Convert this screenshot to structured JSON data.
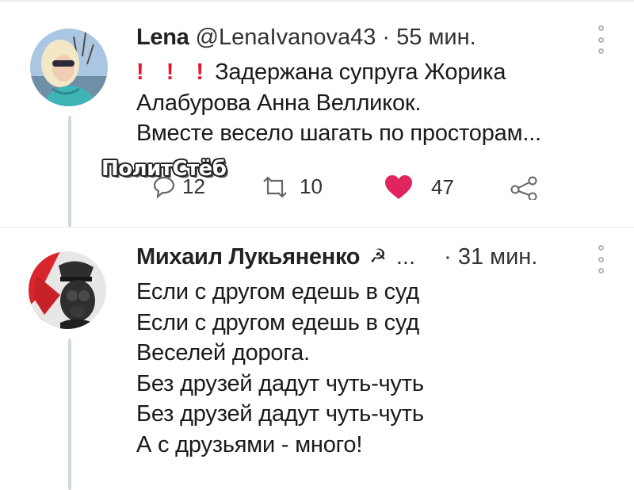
{
  "thread": [
    {
      "author_name": "Lena",
      "author_handle": "@LenaIvanova43",
      "separator": "·",
      "time": "55 мин.",
      "exclamations": "! ! !",
      "body_lines": [
        "Задержана супруга Жорика",
        "Алабурова Анна Велликок.",
        "Вместе весело шагать по просторам..."
      ],
      "reply_count": "12",
      "retweet_count": "10",
      "like_count": "47",
      "like_color": "#e0245e"
    },
    {
      "author_name": "Михаил Лукьяненко",
      "author_badge": "☭",
      "ellipsis": "...",
      "separator": "·",
      "time": "31 мин.",
      "body_lines": [
        "Если с другом едешь в суд",
        "Если с другом едешь в суд",
        "Веселей дорога.",
        "Без друзей дадут чуть-чуть",
        "Без друзей дадут чуть-чуть",
        "А с друзьями - много!"
      ]
    }
  ],
  "watermark": "ПолитСтёб",
  "icons": [
    "more-vertical-icon",
    "reply-icon",
    "retweet-icon",
    "heart-icon",
    "share-icon"
  ]
}
